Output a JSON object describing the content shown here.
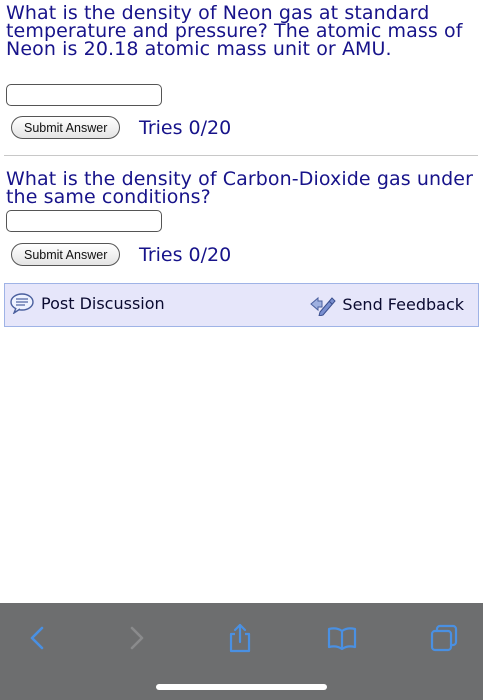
{
  "questions": [
    {
      "text": "What is the density of Neon gas at standard temperature and pressure? The atomic mass of Neon is 20.18 atomic mass unit or AMU.",
      "answer_value": "",
      "submit_label": "Submit Answer",
      "tries": "Tries 0/20"
    },
    {
      "text": "What is the density of Carbon-Dioxide gas under the same conditions?",
      "answer_value": "",
      "submit_label": "Submit Answer",
      "tries": "Tries 0/20"
    }
  ],
  "footer": {
    "post_discussion": "Post Discussion",
    "send_feedback": "Send Feedback",
    "post_icon": "discussion-bubble-icon",
    "feedback_icon": "feedback-pencil-icon"
  },
  "toolbar": {
    "icons": [
      "back-chevron-icon",
      "forward-chevron-icon",
      "share-icon",
      "bookmarks-book-icon",
      "tabs-icon"
    ],
    "accent": "#4a90e2",
    "disabled": "#8a8b8c",
    "background": "#6d6e6f"
  },
  "colors": {
    "question_text": "#17138a",
    "footer_bg": "#e6e6fa"
  }
}
